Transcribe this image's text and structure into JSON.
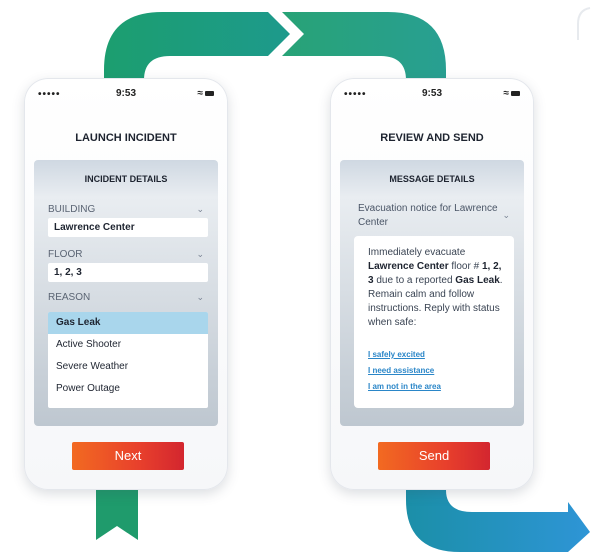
{
  "colors": {
    "ribbon_green": "#1fa57a",
    "ribbon_teal": "#1b8fa8",
    "ribbon_blue": "#2b8fd0",
    "button_orange": "#f26a21",
    "button_red": "#d3262f",
    "selected_option": "#a9d6ec",
    "link_blue": "#2a86c8"
  },
  "phone1": {
    "status": {
      "signal": "•••••",
      "time": "9:53",
      "wifi_icon": "wifi-icon",
      "battery_icon": "battery-icon"
    },
    "title": "LAUNCH INCIDENT",
    "panel_title": "INCIDENT DETAILS",
    "building": {
      "label": "BUILDING",
      "value": "Lawrence Center"
    },
    "floor": {
      "label": "FLOOR",
      "value": "1, 2, 3"
    },
    "reason": {
      "label": "REASON",
      "selected": "Gas Leak",
      "options": [
        "Gas Leak",
        "Active Shooter",
        "Severe Weather",
        "Power Outage"
      ]
    },
    "next_label": "Next"
  },
  "phone2": {
    "status": {
      "signal": "•••••",
      "time": "9:53",
      "wifi_icon": "wifi-icon",
      "battery_icon": "battery-icon"
    },
    "title": "REVIEW AND SEND",
    "panel_title": "MESSAGE DETAILS",
    "subject": "Evacuation notice for Lawrence Center",
    "message": {
      "p1": "Immediately evacuate ",
      "building": "Lawrence Center",
      "p2": " floor # ",
      "floors": "1, 2, 3",
      "p3": " due to a reported ",
      "reason": "Gas Leak",
      "p4": ". Remain calm and follow instructions. Reply with status when safe:"
    },
    "replies": [
      "I safely excited",
      "I need assistance",
      "I am not in the area"
    ],
    "send_label": "Send"
  }
}
